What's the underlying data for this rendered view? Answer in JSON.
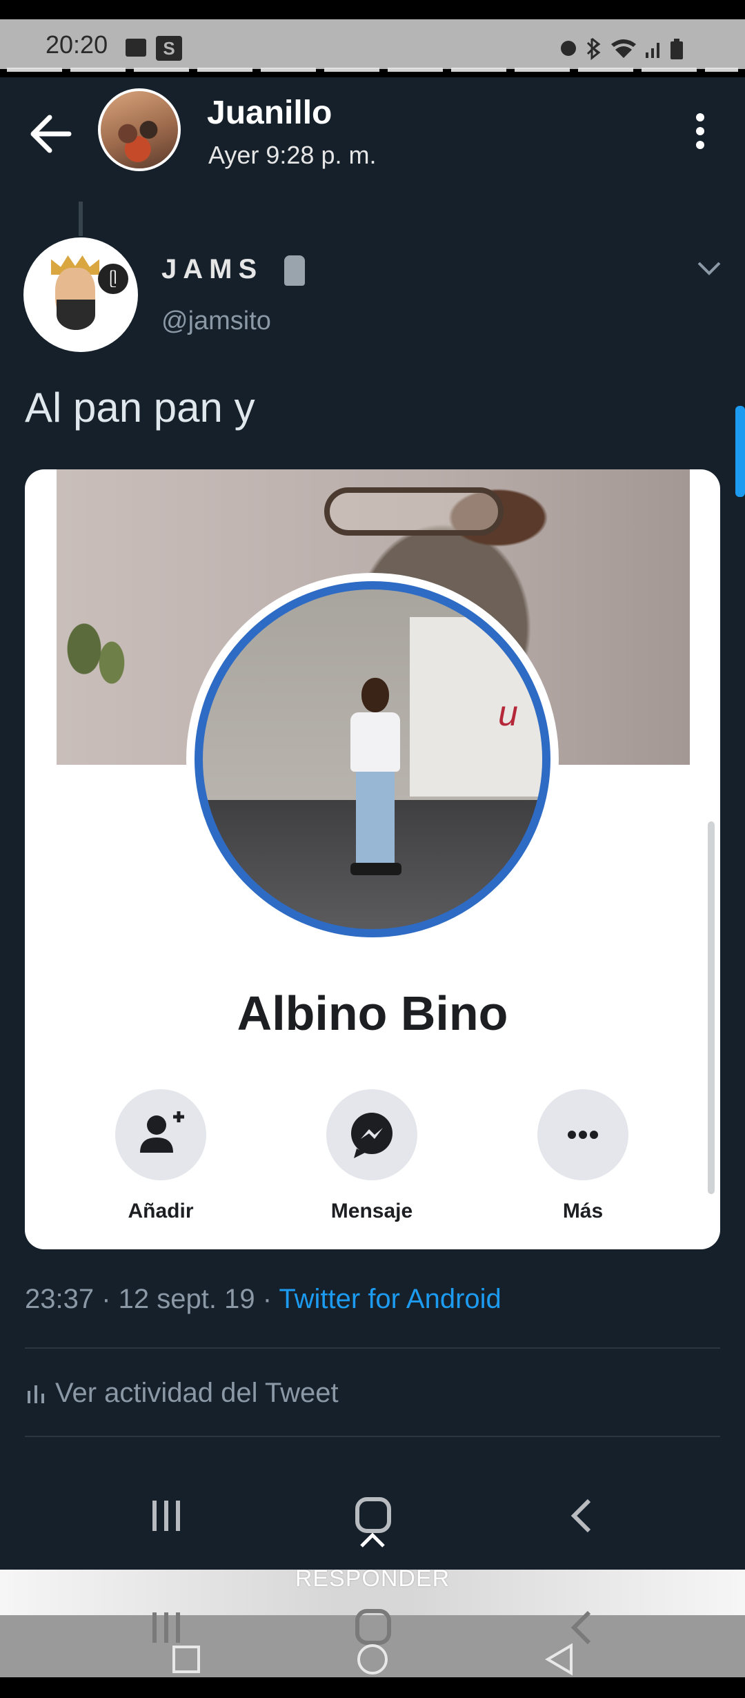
{
  "status_bar": {
    "time": "20:20",
    "s_badge": "S",
    "right_icons": [
      "alarm-icon",
      "bluetooth-icon",
      "wifi-icon",
      "signal-icon",
      "battery-icon"
    ]
  },
  "chat_header": {
    "name": "Juanillo",
    "subtitle": "Ayer 9:28 p. m.",
    "icons": [
      "back-arrow-icon",
      "more-vert-icon"
    ]
  },
  "tweet": {
    "display_name": "JAMS",
    "handle": "@jamsito",
    "text": "Al pan pan y",
    "timestamp": "23:37 · 12 sept. 19 · ",
    "source": "Twitter for Android",
    "activity": "Ver actividad del Tweet",
    "avatar_bubble_text": "ᥫ"
  },
  "fb_card": {
    "profile_name": "Albino Bino",
    "actions": [
      {
        "label": "Añadir",
        "icon": "add-friend-icon"
      },
      {
        "label": "Mensaje",
        "icon": "messenger-icon"
      },
      {
        "label": "Más",
        "icon": "more-horizontal-icon"
      }
    ],
    "cover_mark": "u"
  },
  "footer": {
    "responder": "RESPONDER"
  },
  "colors": {
    "twitter_bg": "#15202b",
    "twitter_blue": "#1d9bf0",
    "fb_ring": "#2d6bc4"
  }
}
